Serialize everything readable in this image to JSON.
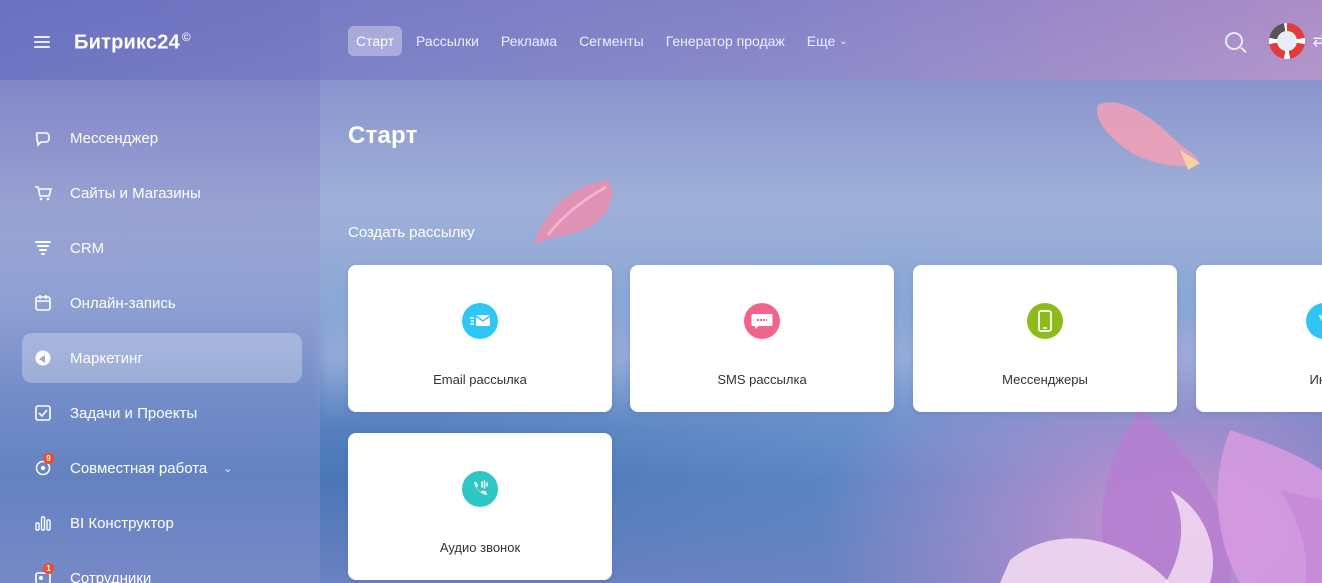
{
  "header": {
    "logo_text": "Битрикс24",
    "logo_mark": "©",
    "nav": [
      {
        "label": "Старт",
        "active": true
      },
      {
        "label": "Рассылки",
        "active": false
      },
      {
        "label": "Реклама",
        "active": false
      },
      {
        "label": "Сегменты",
        "active": false
      },
      {
        "label": "Генератор продаж",
        "active": false
      },
      {
        "label": "Еще",
        "active": false
      }
    ]
  },
  "sidebar": {
    "items": [
      {
        "label": "Мессенджер",
        "icon": "chat-icon"
      },
      {
        "label": "Сайты и Магазины",
        "icon": "cart-icon"
      },
      {
        "label": "CRM",
        "icon": "funnel-icon"
      },
      {
        "label": "Онлайн-запись",
        "icon": "calendar-icon"
      },
      {
        "label": "Маркетинг",
        "icon": "marketing-icon",
        "active": true
      },
      {
        "label": "Задачи и Проекты",
        "icon": "checkbox-icon"
      },
      {
        "label": "Совместная работа",
        "icon": "collab-icon",
        "badge": "9"
      },
      {
        "label": "BI Конструктор",
        "icon": "bar-chart-icon"
      },
      {
        "label": "Сотрудники",
        "icon": "employees-icon",
        "badge": "1"
      }
    ]
  },
  "main": {
    "title": "Старт",
    "section_title": "Создать рассылку",
    "cards": [
      {
        "label": "Email рассылка",
        "icon": "email-icon",
        "color": "#2fc6f6"
      },
      {
        "label": "SMS рассылка",
        "icon": "sms-icon",
        "color": "#f2638c"
      },
      {
        "label": "Мессенджеры",
        "icon": "phone-icon",
        "color": "#8dbb1a"
      },
      {
        "label": "Инфо",
        "icon": "info-call-icon",
        "color": "#2fc6f6"
      },
      {
        "label": "Аудио звонок",
        "icon": "audio-call-icon",
        "color": "#2fc6c6"
      }
    ]
  },
  "colors": {
    "email": "#2fc6f6",
    "sms": "#f2638c",
    "messengers": "#8dbb1a",
    "audio": "#2fc6c6",
    "badge": "#f04c2a"
  }
}
